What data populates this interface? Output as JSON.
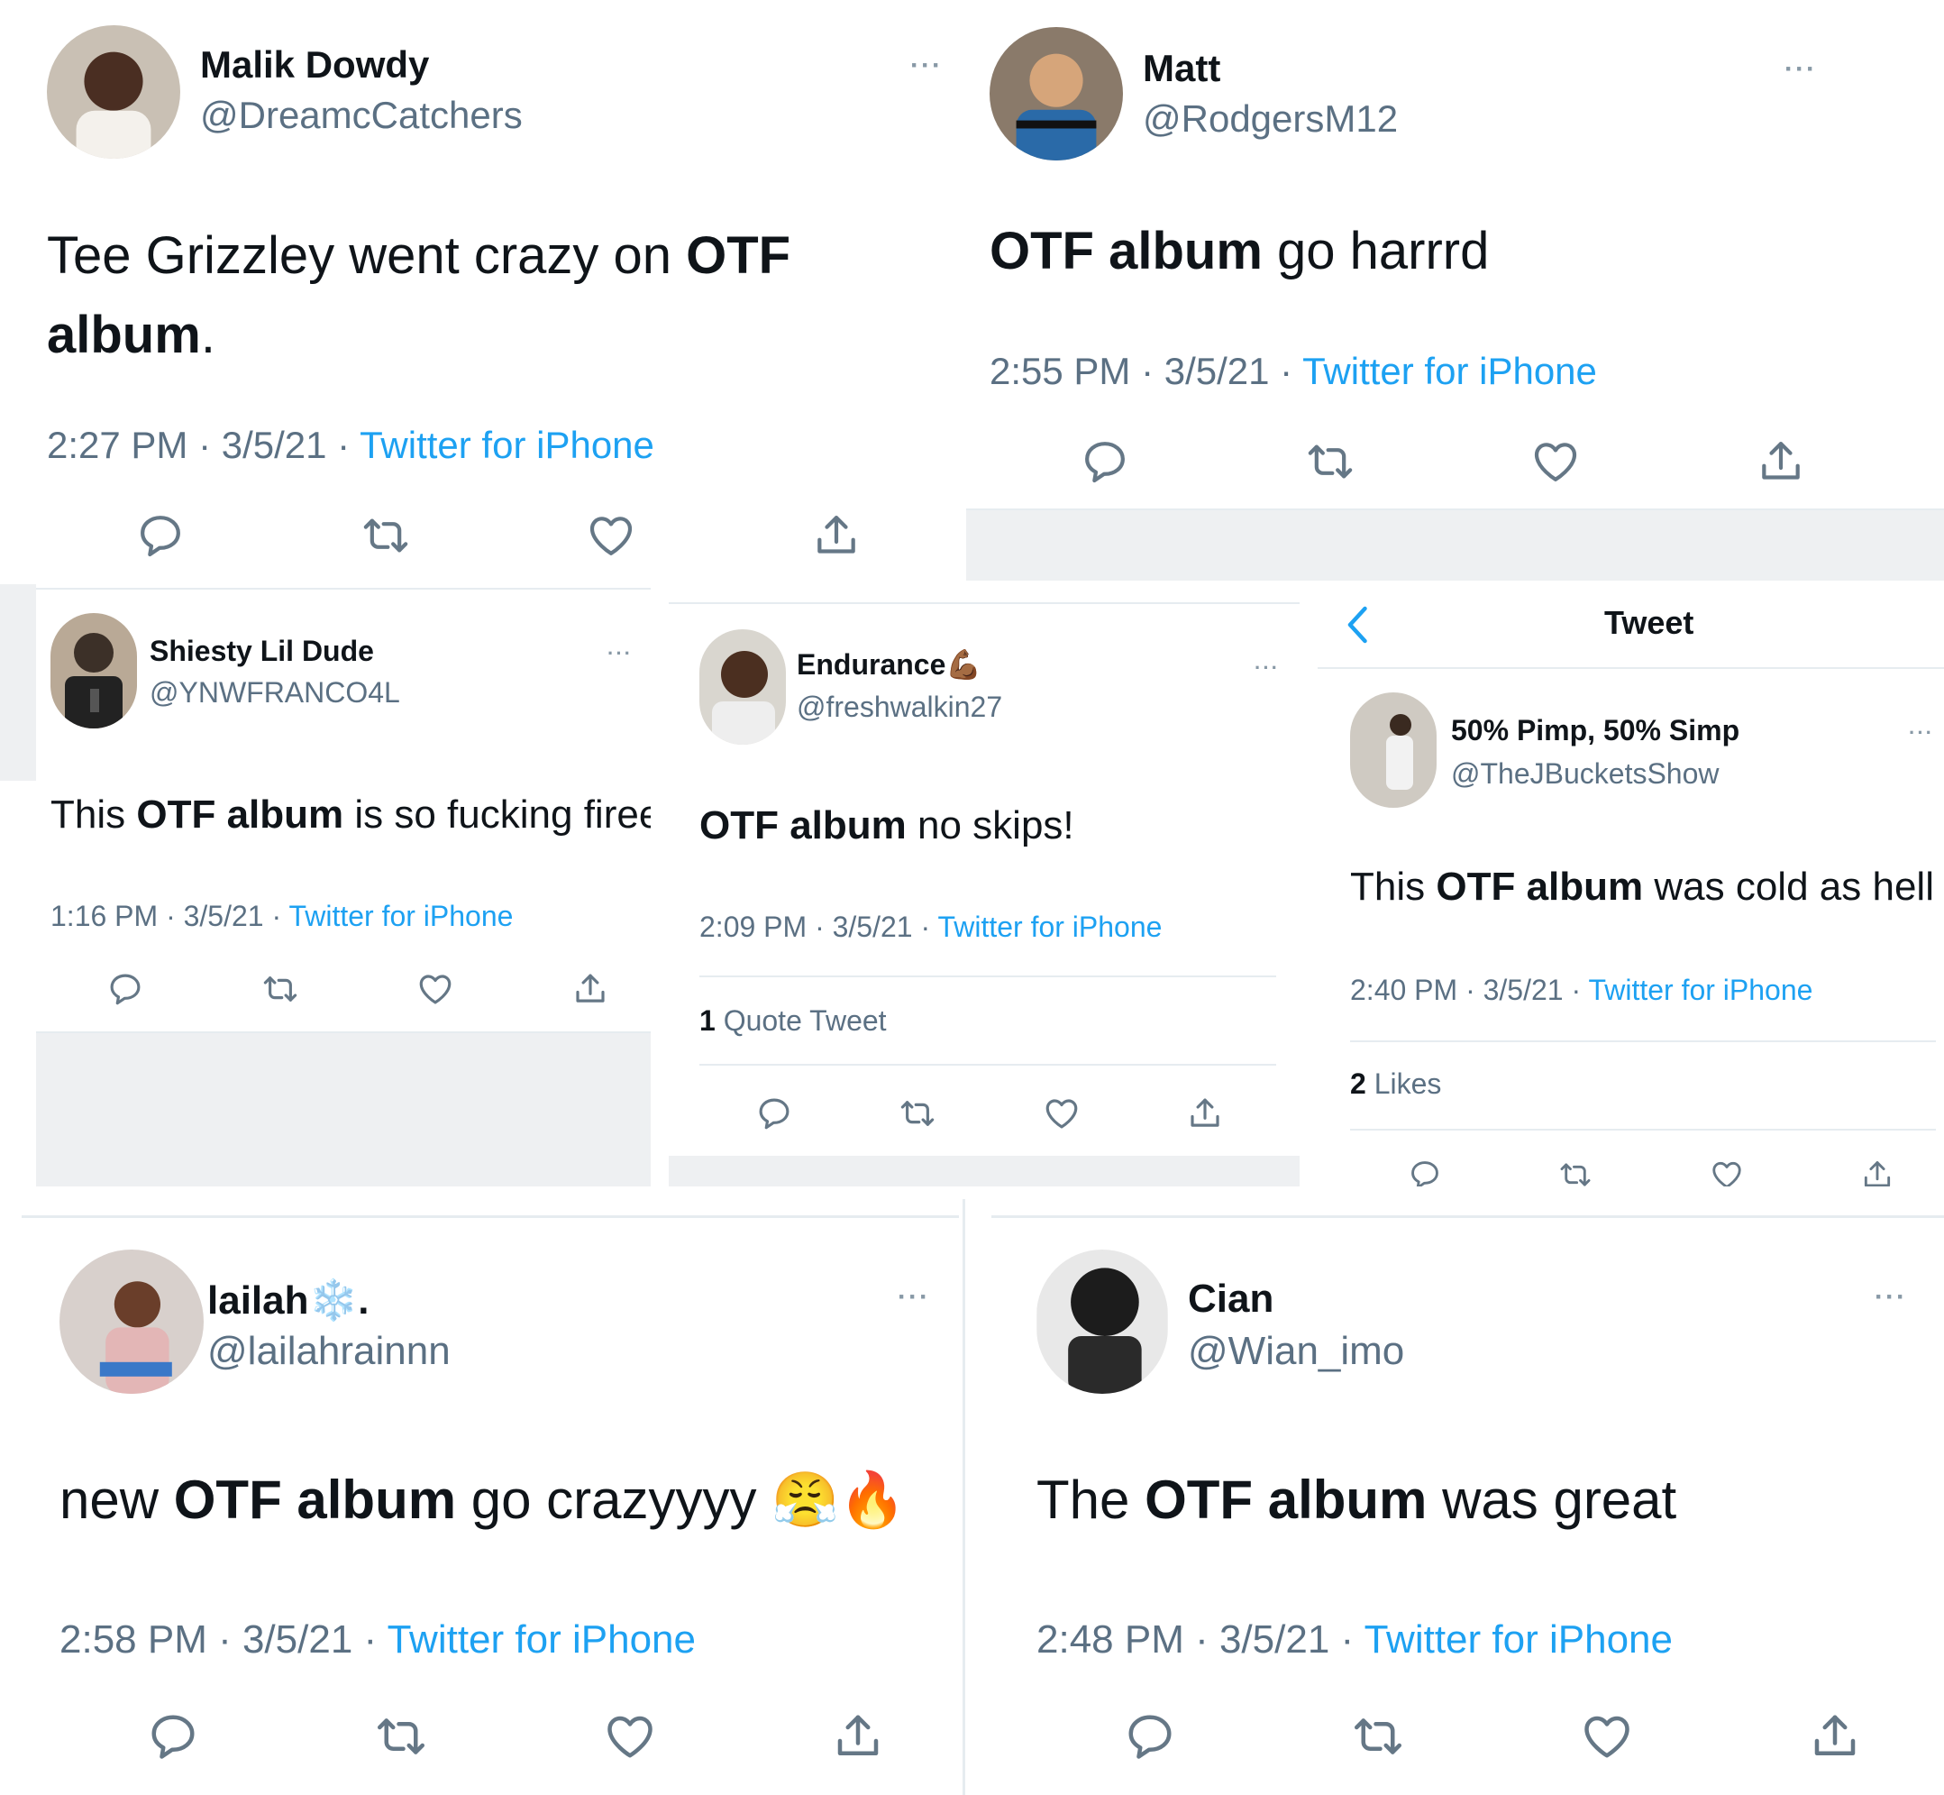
{
  "tweets": [
    {
      "name": "Malik Dowdy",
      "handle": "@DreamcCatchers",
      "text_before": "Tee Grizzley went crazy on ",
      "text_bold": "OTF album",
      "text_after": ".",
      "time": "2:27 PM · 3/5/21 · ",
      "source": "Twitter for iPhone"
    },
    {
      "name": "Matt",
      "handle": "@RodgersM12",
      "text_before": "",
      "text_bold": "OTF album",
      "text_after": " go harrrd",
      "time": "2:55 PM · 3/5/21 · ",
      "source": "Twitter for iPhone"
    },
    {
      "name": "Shiesty Lil Dude",
      "handle": "@YNWFRANCO4L",
      "text_before": "This ",
      "text_bold": "OTF album",
      "text_after": " is so fucking fireeeee",
      "time": "1:16 PM · 3/5/21 · ",
      "source": "Twitter for iPhone"
    },
    {
      "name": "Endurance💪🏾",
      "handle": "@freshwalkin27",
      "text_before": "",
      "text_bold": "OTF album",
      "text_after": " no skips!",
      "time": "2:09 PM · 3/5/21 · ",
      "source": "Twitter for iPhone",
      "stat_count": "1",
      "stat_label": " Quote Tweet"
    },
    {
      "header_title": "Tweet",
      "name": "50% Pimp, 50% Simp",
      "handle": "@TheJBucketsShow",
      "text_before": "This ",
      "text_bold": "OTF album",
      "text_after": " was cold as hell",
      "time": "2:40 PM · 3/5/21 · ",
      "source": "Twitter for iPhone",
      "stat_count": "2",
      "stat_label": " Likes"
    },
    {
      "name": "lailah❄️.",
      "handle": "@lailahrainnn",
      "text_before": "new ",
      "text_bold": "OTF album",
      "text_after": " go crazyyyy 😤🔥",
      "time": "2:58 PM · 3/5/21 · ",
      "source": "Twitter for iPhone"
    },
    {
      "name": "Cian",
      "handle": "@Wian_imo",
      "text_before": "The ",
      "text_bold": "OTF album",
      "text_after": " was great",
      "time": "2:48 PM · 3/5/21 · ",
      "source": "Twitter for iPhone"
    }
  ],
  "more_label": "···",
  "icons": [
    "reply-icon",
    "retweet-icon",
    "like-icon",
    "share-icon",
    "back-chevron-icon"
  ],
  "colors": {
    "link": "#1da1f2",
    "muted": "#5b7083",
    "text": "#0f1419",
    "icon": "#657786"
  }
}
